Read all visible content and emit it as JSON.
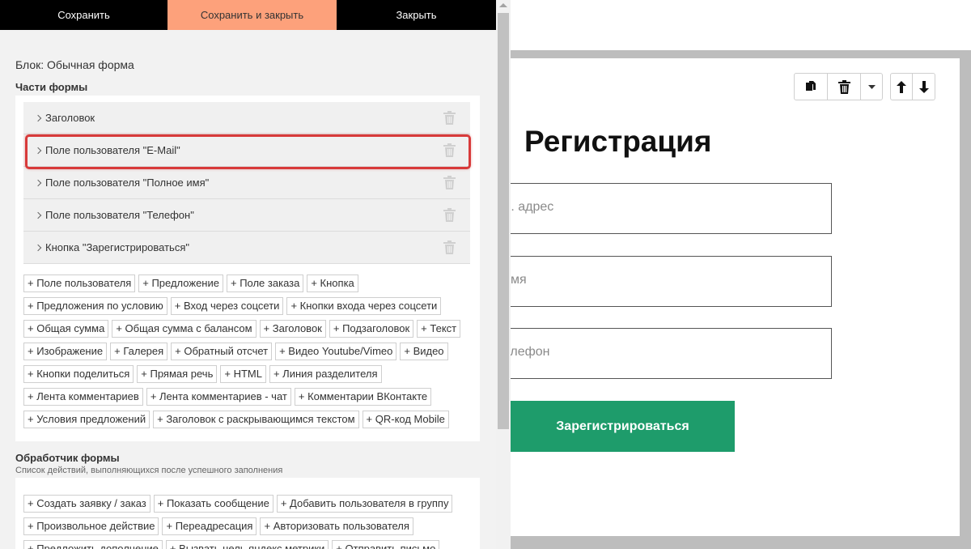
{
  "topbar": {
    "save": "Сохранить",
    "save_and_close": "Сохранить и закрыть",
    "close": "Закрыть"
  },
  "block_label": "Блок: Обычная форма",
  "parts_section": {
    "title": "Части формы",
    "items": [
      {
        "label": "Заголовок"
      },
      {
        "label": "Поле пользователя \"E-Mail\""
      },
      {
        "label": "Поле пользователя \"Полное имя\""
      },
      {
        "label": "Поле пользователя \"Телефон\""
      },
      {
        "label": "Кнопка \"Зарегистрироваться\""
      }
    ],
    "add_buttons": [
      [
        "+ Поле пользователя",
        "+ Предложение",
        "+ Поле заказа",
        "+ Кнопка"
      ],
      [
        "+ Предложения по условию",
        "+ Вход через соцсети",
        "+ Кнопки входа через соцсети"
      ],
      [
        "+ Общая сумма",
        "+ Общая сумма с балансом",
        "+ Заголовок",
        "+ Подзаголовок",
        "+ Текст"
      ],
      [
        "+ Изображение",
        "+ Галерея",
        "+ Обратный отсчет",
        "+ Видео Youtube/Vimeo",
        "+ Видео"
      ],
      [
        "+ Кнопки поделиться",
        "+ Прямая речь",
        "+ HTML",
        "+ Линия разделителя"
      ],
      [
        "+ Лента комментариев",
        "+ Лента комментариев - чат",
        "+ Комментарии ВКонтакте"
      ],
      [
        "+ Условия предложений",
        "+ Заголовок с раскрывающимся текстом",
        "+ QR-код Mobile"
      ]
    ]
  },
  "handler_section": {
    "title": "Обработчик формы",
    "subtitle": "Список действий, выполняющихся после успешного заполнения",
    "add_buttons": [
      [
        "+ Создать заявку / заказ",
        "+ Показать сообщение",
        "+ Добавить пользователя в группу"
      ],
      [
        "+ Произвольное действие",
        "+ Переадресация",
        "+ Авторизовать пользователя"
      ],
      [
        "+ Предложить дополнение",
        "+ Вызвать цель яндекс метрики",
        "+ Отправить письмо"
      ]
    ]
  },
  "preview": {
    "title": "Регистрация",
    "fields": [
      {
        "placeholder": "л. адрес"
      },
      {
        "placeholder": "имя"
      },
      {
        "placeholder": "елефон"
      }
    ],
    "submit": "Зарегистрироваться",
    "accent_color": "#1e9c6b"
  },
  "colors": {
    "save_and_close_bg": "#fda17b",
    "highlight_border": "#d83a3a"
  }
}
